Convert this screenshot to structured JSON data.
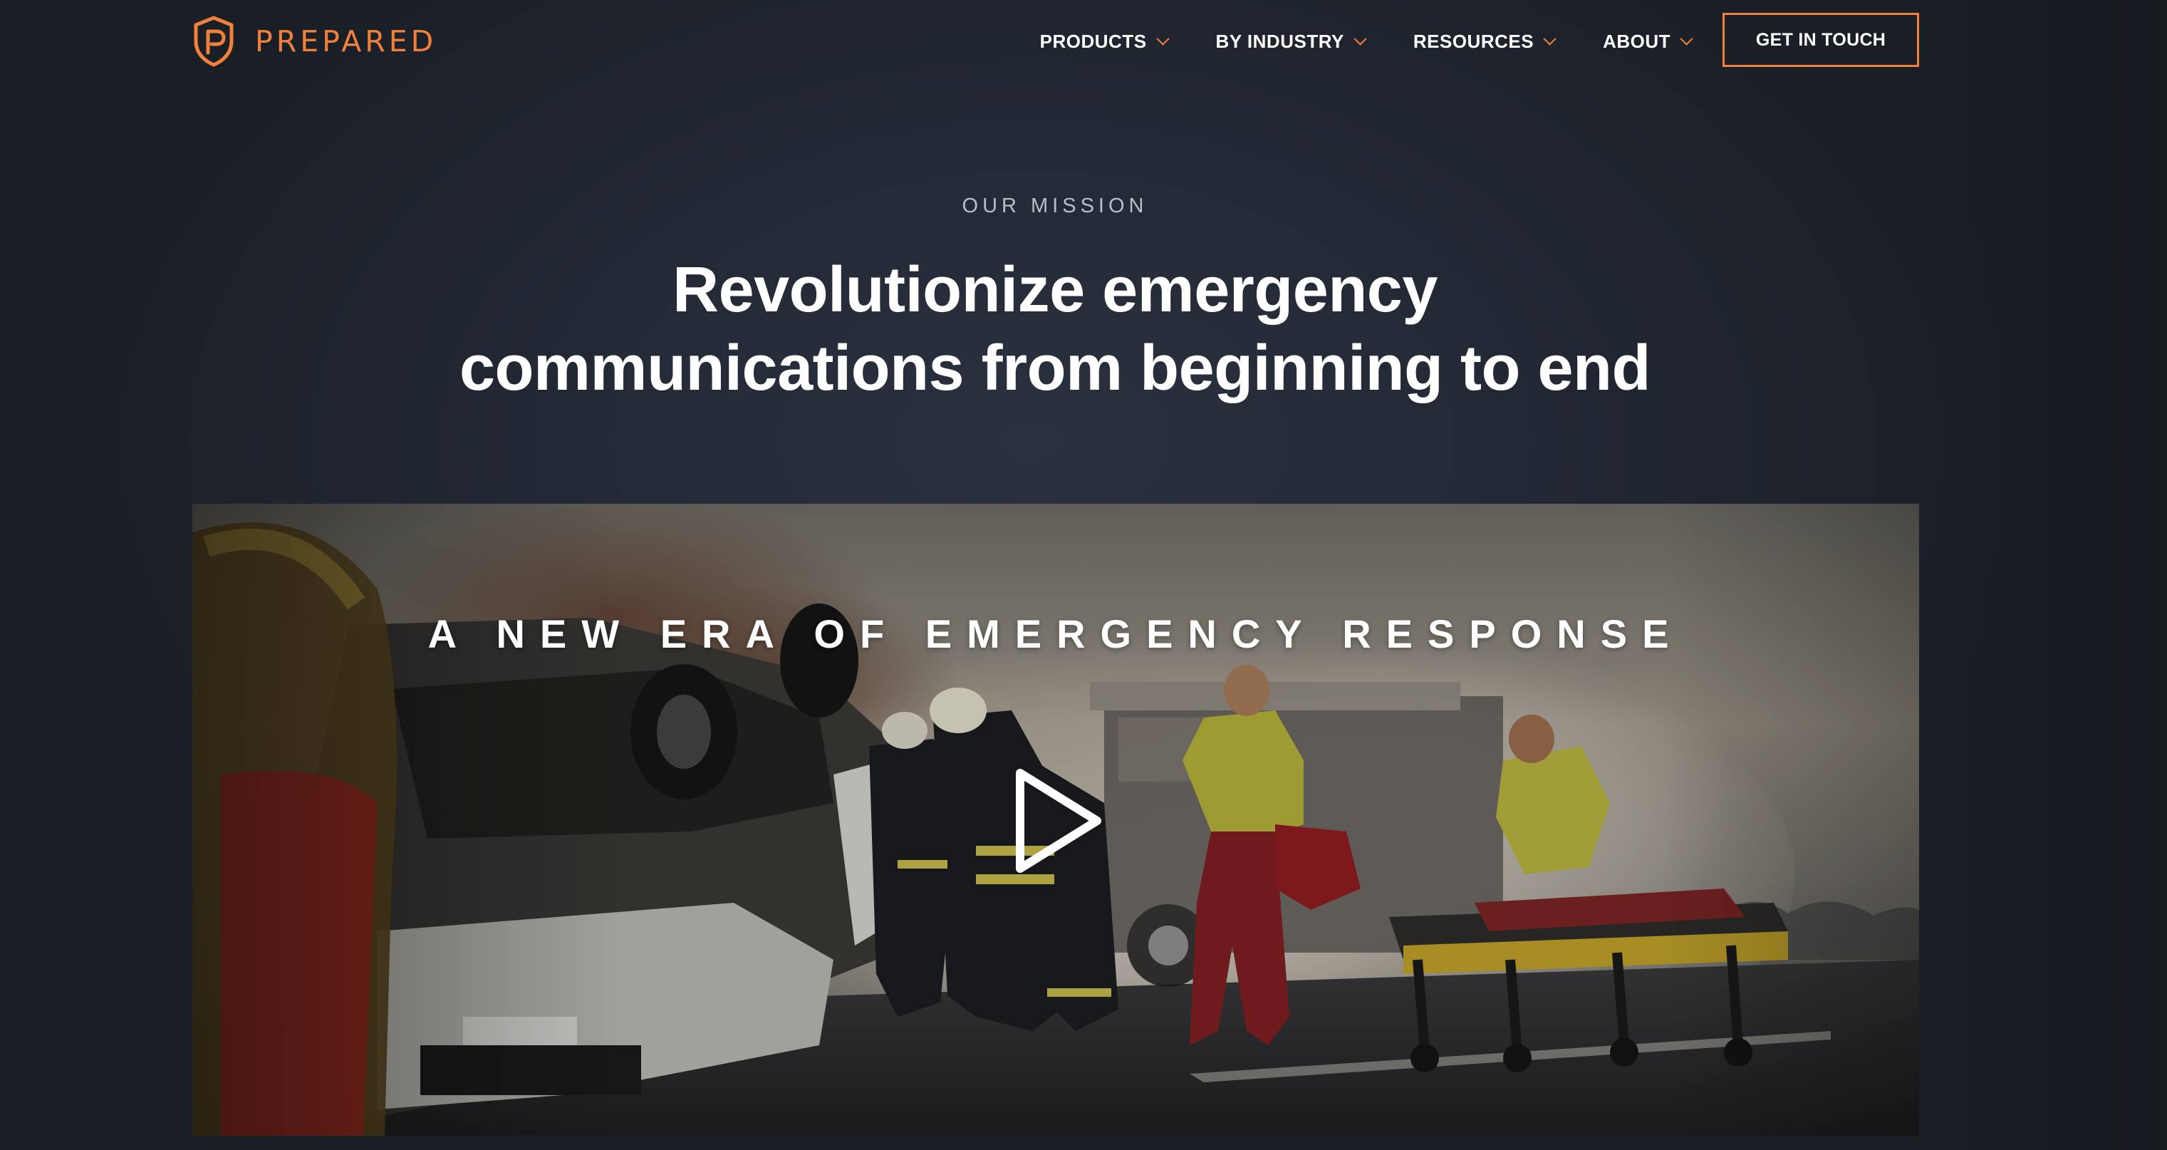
{
  "brand": {
    "name": "PREPARED",
    "accent_color": "#f0813c",
    "logo_icon": "shield-p-icon"
  },
  "nav": {
    "items": [
      {
        "label": "PRODUCTS",
        "icon": "chevron-down-icon"
      },
      {
        "label": "BY INDUSTRY",
        "icon": "chevron-down-icon"
      },
      {
        "label": "RESOURCES",
        "icon": "chevron-down-icon"
      },
      {
        "label": "ABOUT",
        "icon": "chevron-down-icon"
      }
    ],
    "cta_label": "GET IN TOUCH"
  },
  "hero": {
    "eyebrow": "OUR MISSION",
    "headline_line1": "Revolutionize emergency",
    "headline_line2": "communications from beginning to end"
  },
  "video": {
    "title": "A NEW ERA OF EMERGENCY RESPONSE",
    "play_icon": "play-icon"
  }
}
